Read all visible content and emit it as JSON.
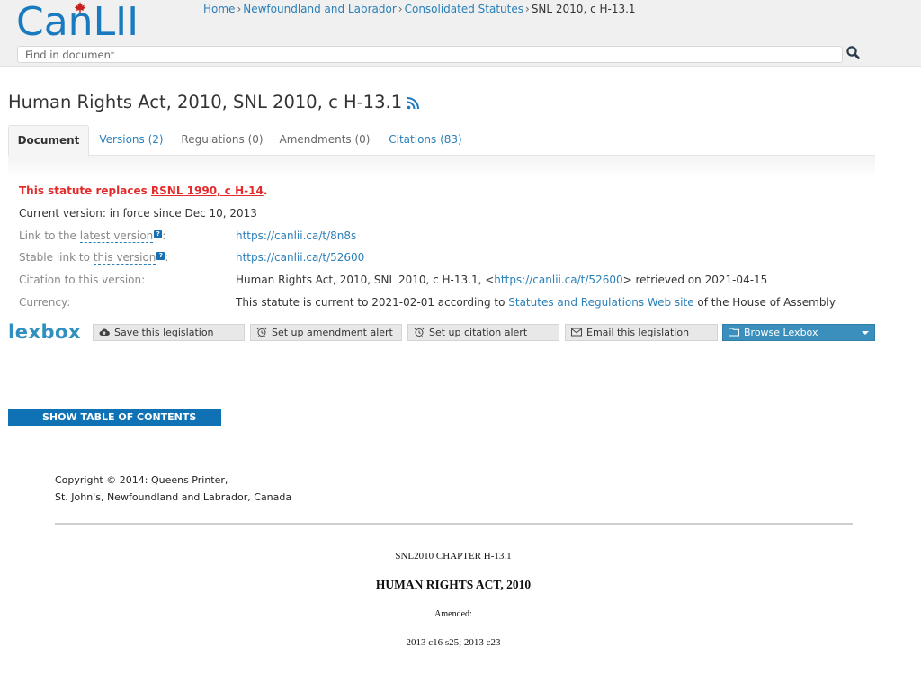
{
  "header": {
    "logo_text": "CanLII",
    "breadcrumb": [
      {
        "label": "Home",
        "link": true
      },
      {
        "label": "Newfoundland and Labrador",
        "link": true
      },
      {
        "label": "Consolidated Statutes",
        "link": true
      },
      {
        "label": "SNL 2010, c H-13.1",
        "link": false
      }
    ],
    "breadcrumb_separator": "›",
    "search_placeholder": "Find in document",
    "search_value": ""
  },
  "page": {
    "title": "Human Rights Act, 2010, SNL 2010, c H-13.1",
    "tabs": [
      {
        "label": "Document",
        "state": "active"
      },
      {
        "label": "Versions (2)",
        "state": "link"
      },
      {
        "label": "Regulations (0)",
        "state": "disabled"
      },
      {
        "label": "Amendments (0)",
        "state": "disabled"
      },
      {
        "label": "Citations (83)",
        "state": "link"
      }
    ]
  },
  "info": {
    "notice_prefix": "This statute replaces ",
    "notice_link": "RSNL 1990, c H-14",
    "notice_suffix": ".",
    "current_version": "Current version: in force since Dec 10, 2013",
    "rows": [
      {
        "label_prefix": "Link to the ",
        "label_dotted": "latest version",
        "label_suffix": ":",
        "help": "?",
        "value_link": "https://canlii.ca/t/8n8s"
      },
      {
        "label_prefix": "Stable link to ",
        "label_dotted": "this version",
        "label_suffix": ":",
        "help": "?",
        "value_link": "https://canlii.ca/t/52600"
      },
      {
        "label": "Citation to this version:",
        "value_prefix": "Human Rights Act, 2010, SNL 2010, c H-13.1, <",
        "value_link": "https://canlii.ca/t/52600",
        "value_suffix": "> retrieved on 2021-04-15"
      },
      {
        "label": "Currency:",
        "value_prefix": "This statute is current to 2021-02-01 according to ",
        "value_link": "Statutes and Regulations Web site",
        "value_suffix": " of the House of Assembly"
      }
    ]
  },
  "lexbox": {
    "brand": "lexbox",
    "buttons": [
      {
        "label": "Save this legislation",
        "icon": "cloud-upload-icon"
      },
      {
        "label": "Set up amendment alert",
        "icon": "alarm-clock-icon"
      },
      {
        "label": "Set up citation alert",
        "icon": "alarm-clock-icon"
      },
      {
        "label": "Email this legislation",
        "icon": "envelope-icon"
      },
      {
        "label": "Browse Lexbox",
        "icon": "folder-icon"
      }
    ]
  },
  "toc_button": "SHOW TABLE OF CONTENTS",
  "document": {
    "copyright_line1": "Copyright © 2014: Queens Printer,",
    "copyright_line2": "St. John's, Newfoundland and Labrador, Canada",
    "chapter": "SNL2010 CHAPTER H-13.1",
    "act_title": "HUMAN RIGHTS ACT, 2010",
    "amended_label": "Amended:",
    "amendments": "2013 c16 s25; 2013 c23"
  },
  "colors": {
    "brand_blue": "#1a7ac0",
    "link": "#2a7fb8",
    "notice_red": "#e32b2b",
    "toc_button": "#0e72b5",
    "lexbox_primary": "#3a8fbd"
  }
}
